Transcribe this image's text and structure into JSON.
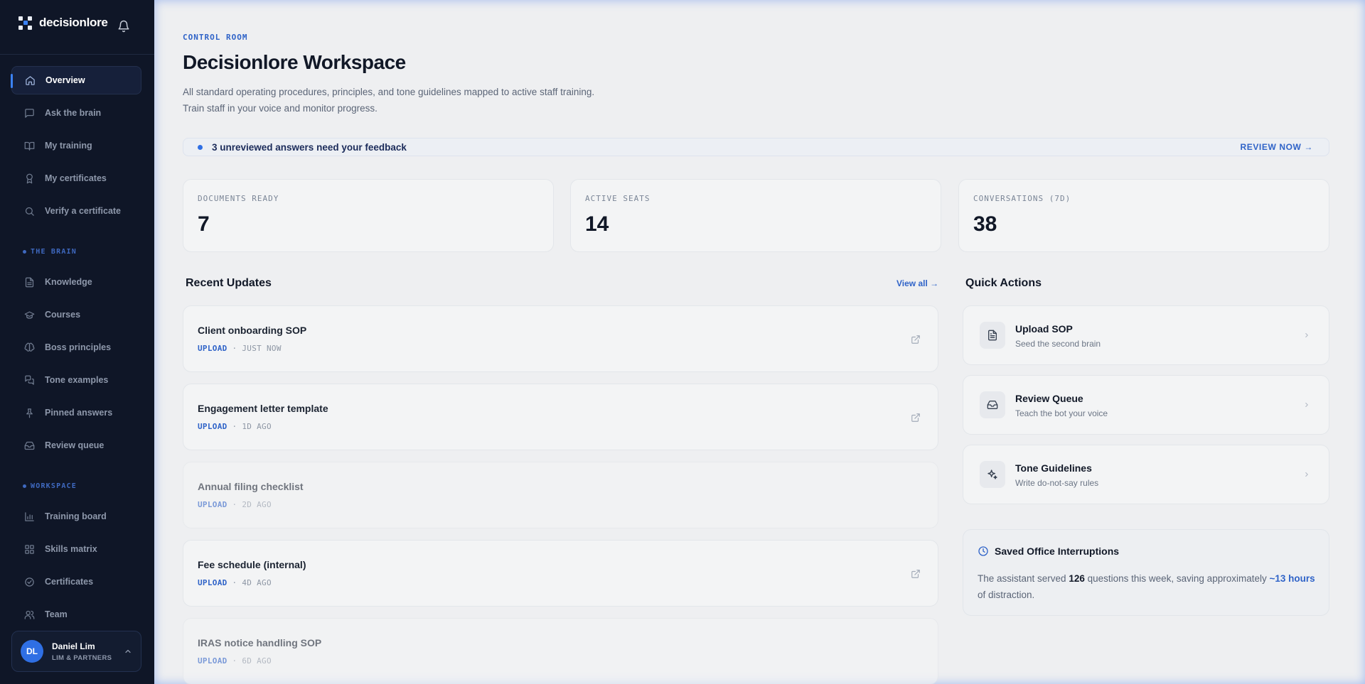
{
  "brand": {
    "name": "decisionlore"
  },
  "sidebar": {
    "items": [
      {
        "label": "Overview",
        "icon": "home-icon"
      },
      {
        "label": "Ask the brain",
        "icon": "chat-icon"
      },
      {
        "label": "My training",
        "icon": "book-icon"
      },
      {
        "label": "My certificates",
        "icon": "award-icon"
      },
      {
        "label": "Verify a certificate",
        "icon": "search-icon"
      }
    ],
    "brain_label": "THE BRAIN",
    "brain_items": [
      {
        "label": "Knowledge",
        "icon": "document-icon"
      },
      {
        "label": "Courses",
        "icon": "graduation-cap-icon"
      },
      {
        "label": "Boss principles",
        "icon": "brain-icon"
      },
      {
        "label": "Tone examples",
        "icon": "messages-icon"
      },
      {
        "label": "Pinned answers",
        "icon": "pin-icon"
      },
      {
        "label": "Review queue",
        "icon": "inbox-icon"
      }
    ],
    "workspace_label": "WORKSPACE",
    "workspace_items": [
      {
        "label": "Training board",
        "icon": "bar-chart-icon"
      },
      {
        "label": "Skills matrix",
        "icon": "grid-icon"
      },
      {
        "label": "Certificates",
        "icon": "check-circle-icon"
      },
      {
        "label": "Team",
        "icon": "users-icon"
      }
    ]
  },
  "user": {
    "initials": "DL",
    "name": "Daniel Lim",
    "org": "LIM & PARTNERS"
  },
  "header": {
    "eyebrow": "CONTROL ROOM",
    "title": "Decisionlore Workspace",
    "subtitle": "All standard operating procedures, principles, and tone guidelines mapped to active staff training. Train staff in your voice and monitor progress."
  },
  "banner": {
    "text": "3 unreviewed answers need your feedback",
    "action": "REVIEW NOW →"
  },
  "stats": [
    {
      "label": "DOCUMENTS READY",
      "value": "7"
    },
    {
      "label": "ACTIVE SEATS",
      "value": "14"
    },
    {
      "label": "CONVERSATIONS (7D)",
      "value": "38"
    }
  ],
  "recent": {
    "title": "Recent Updates",
    "view_all": "View all →",
    "items": [
      {
        "title": "Client onboarding SOP",
        "type": "UPLOAD",
        "sep": "·",
        "time": "JUST NOW"
      },
      {
        "title": "Engagement letter template",
        "type": "UPLOAD",
        "sep": "·",
        "time": "1D AGO"
      },
      {
        "title": "Annual filing checklist",
        "type": "UPLOAD",
        "sep": "·",
        "time": "2D AGO"
      },
      {
        "title": "Fee schedule (internal)",
        "type": "UPLOAD",
        "sep": "·",
        "time": "4D AGO"
      },
      {
        "title": "IRAS notice handling SOP",
        "type": "UPLOAD",
        "sep": "·",
        "time": "6D AGO"
      }
    ]
  },
  "quick_actions": {
    "title": "Quick Actions",
    "items": [
      {
        "title": "Upload SOP",
        "sub": "Seed the second brain",
        "icon": "file-text-icon"
      },
      {
        "title": "Review Queue",
        "sub": "Teach the bot your voice",
        "icon": "inbox-icon"
      },
      {
        "title": "Tone Guidelines",
        "sub": "Write do-not-say rules",
        "icon": "sparkles-icon"
      }
    ]
  },
  "savings": {
    "title": "Saved Office Interruptions",
    "pre": "The assistant served ",
    "count": "126",
    "mid": " questions this week, saving approximately ",
    "hours": "~13 hours",
    "post": " of distraction."
  },
  "colors": {
    "sidebar_bg": "#0f1627",
    "accent": "#2f63c8",
    "main_bg": "#eeeff1"
  }
}
